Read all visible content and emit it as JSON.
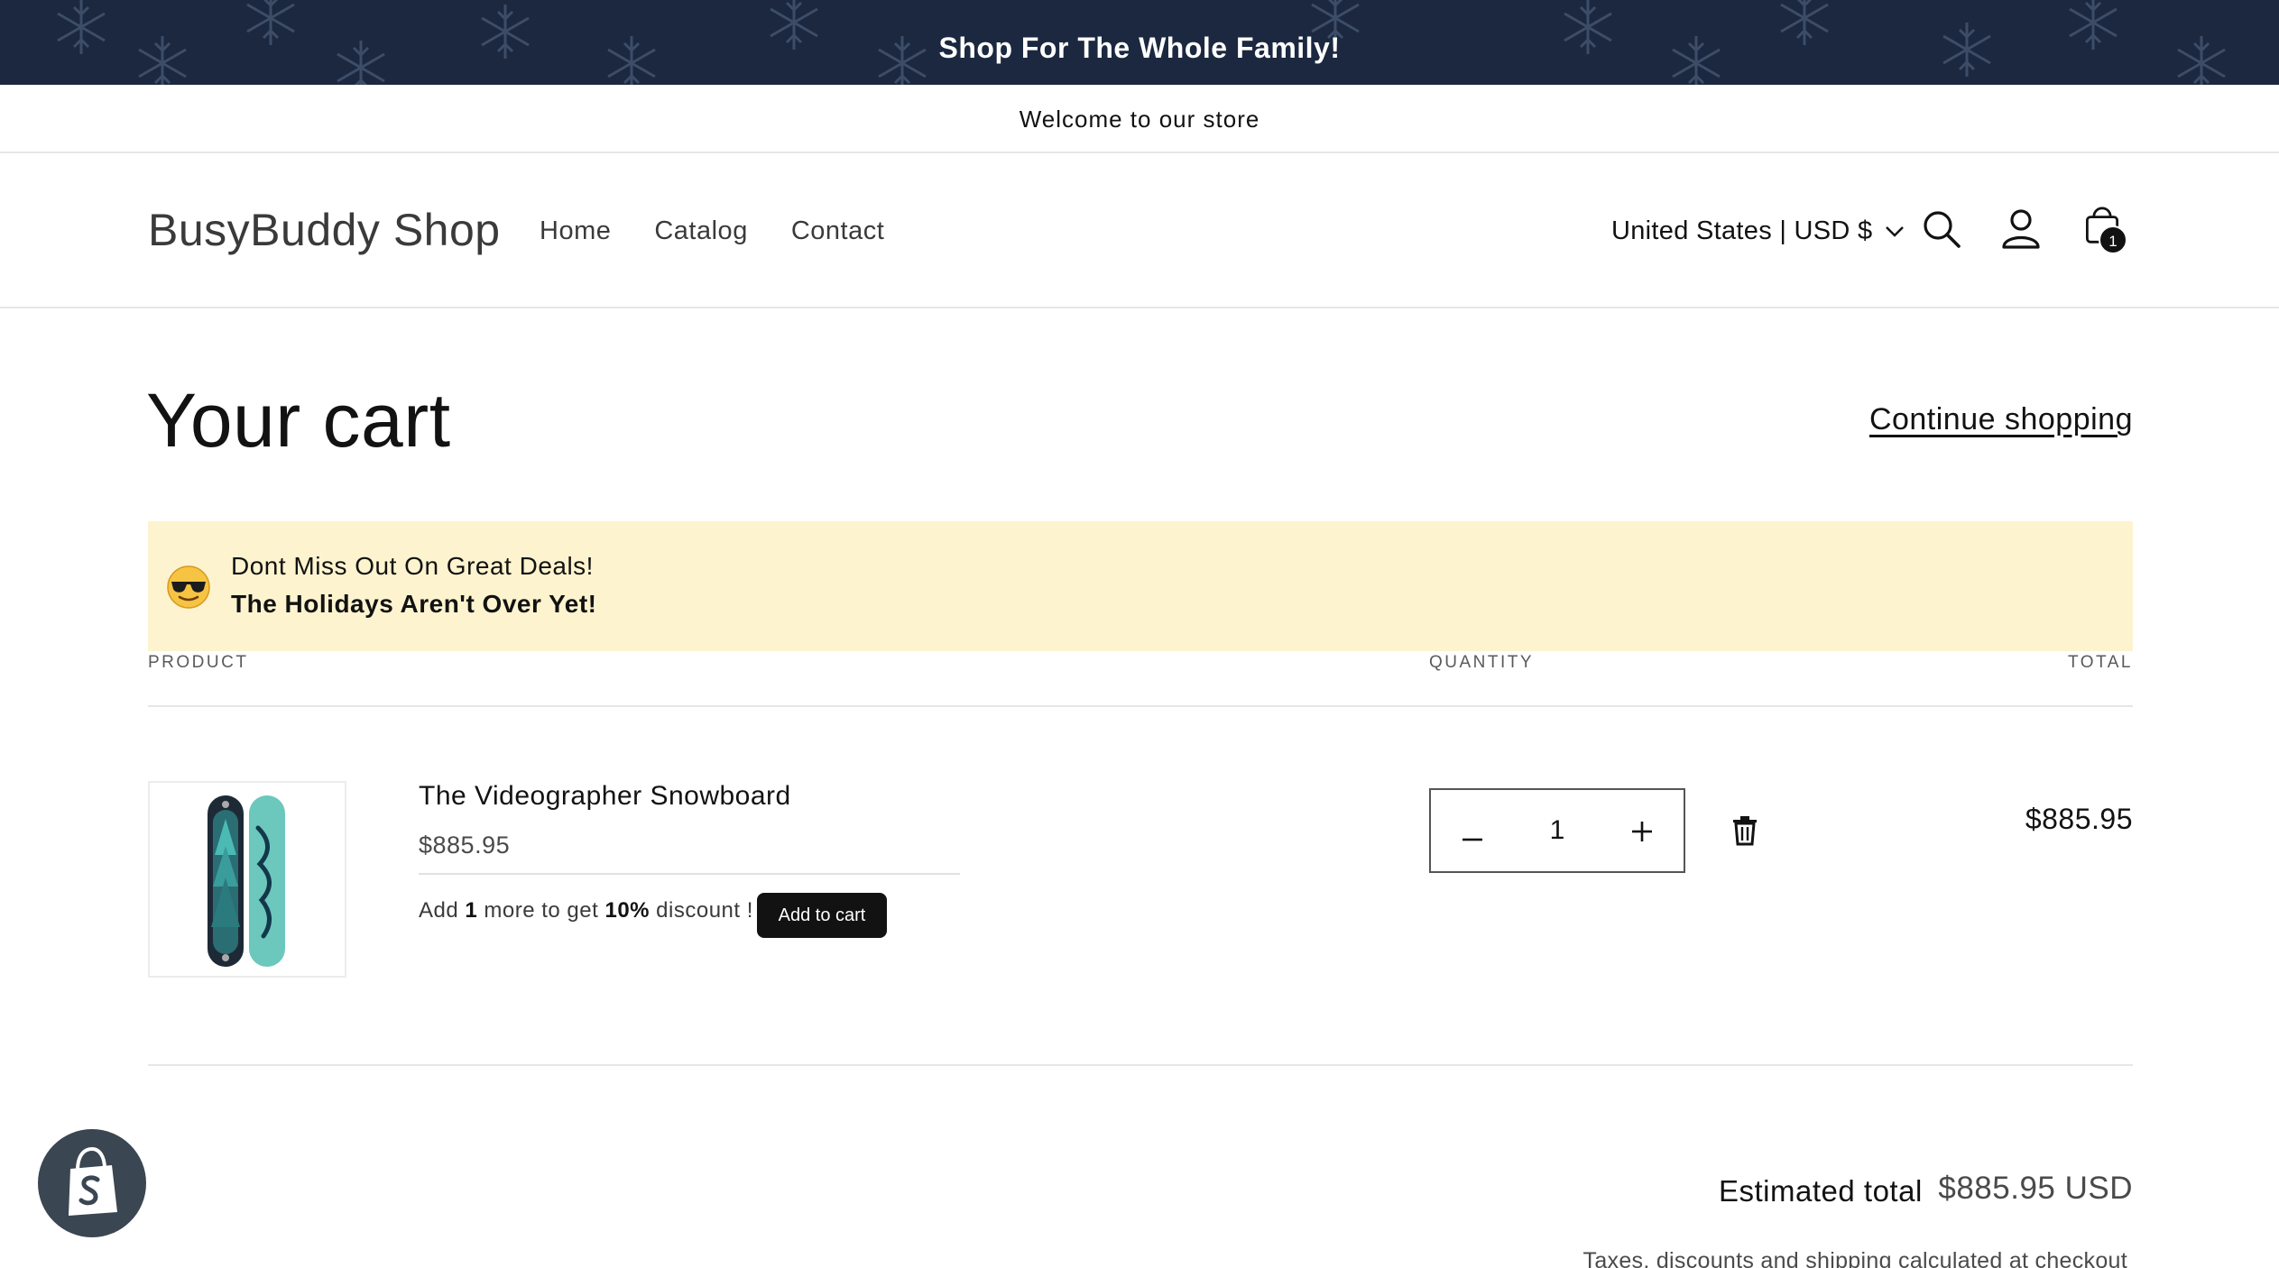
{
  "announcement": {
    "text": "Shop For The Whole Family!"
  },
  "welcome": {
    "text": "Welcome to our store"
  },
  "header": {
    "logo": "BusyBuddy Shop",
    "nav": [
      "Home",
      "Catalog",
      "Contact"
    ],
    "country_selector": "United States | USD $",
    "cart_count": "1"
  },
  "cart": {
    "title": "Your cart",
    "continue_shopping": "Continue shopping",
    "deals": {
      "line1": "Dont Miss Out On Great Deals!",
      "line2": "The Holidays Aren't Over Yet!"
    },
    "columns": {
      "product": "PRODUCT",
      "quantity": "QUANTITY",
      "total": "TOTAL"
    },
    "item": {
      "name": "The Videographer Snowboard",
      "price": "$885.95",
      "upsell_prefix": "Add ",
      "upsell_qty": "1",
      "upsell_mid": " more to get ",
      "upsell_pct": "10%",
      "upsell_suffix": " discount !",
      "add_to_cart": "Add to cart",
      "quantity": "1",
      "line_total": "$885.95"
    },
    "estimated_total_label": "Estimated total",
    "estimated_total_value": "$885.95 USD",
    "taxes_note": "Taxes, discounts and shipping calculated at checkout"
  },
  "colors": {
    "announcement_bg": "#1b2840",
    "deals_bg": "#fdf4cf",
    "button_bg": "#121212",
    "shopify_badge_bg": "#3a4651"
  },
  "icons": [
    "snowflake-icon",
    "chevron-down-icon",
    "search-icon",
    "account-icon",
    "cart-icon",
    "sunglasses-emoji-icon",
    "minus-icon",
    "plus-icon",
    "trash-icon",
    "shopify-bag-icon"
  ]
}
